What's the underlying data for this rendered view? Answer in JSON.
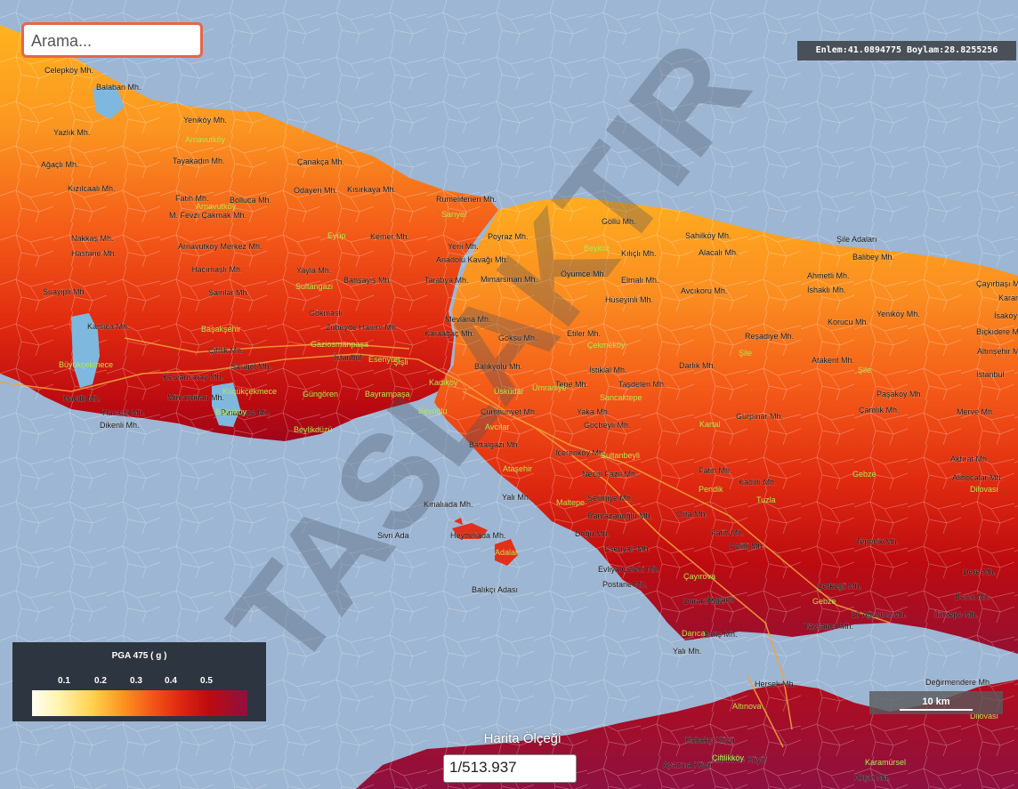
{
  "search": {
    "placeholder": "Arama..."
  },
  "coords": {
    "text": "Enlem:41.0894775 Boylam:28.8255256"
  },
  "legend": {
    "title": "PGA 475 ( g )",
    "ticks": [
      "0.1",
      "0.2",
      "0.3",
      "0.4",
      "0.5"
    ],
    "colors": [
      "#fffdf2",
      "#ffd24d",
      "#fb9521",
      "#f45a18",
      "#e02a10",
      "#bd0b10",
      "#8e1040"
    ]
  },
  "scale": {
    "label": "Harita Ölçeği",
    "value": "1/513.937"
  },
  "scalebar": {
    "label": "10 km"
  },
  "watermark": "TASLAKTIR",
  "water_color": "#9db6d3",
  "labels": {
    "black": [
      "Celepköy Mh.",
      "Balaban Mh.",
      "Yeniköy Mh.",
      "Yazlık Mh.",
      "Tayakadın Mh.",
      "Çanakça Mh.",
      "Ağaçlı Mh.",
      "Kızılcaali Mh.",
      "Fatih Mh.",
      "Bolluca Mh.",
      "Odayeri Mh.",
      "Kısırkaya Mh.",
      "Rumelifeneri Mh.",
      "M. Fevzi Çakmak Mh.",
      "Göllü Mh.",
      "Nakkaş Mh.",
      "Arnavutköy Merkez Mh.",
      "Kemer Mh.",
      "Yeni Mh.",
      "Poyraz Mh.",
      "Sahilköy Mh.",
      "Şile Adaları",
      "Hastane Mh.",
      "Kılıçlı Mh.",
      "Alacalı Mh.",
      "Balibey Mh.",
      "Anadolu Kavağı Mh.",
      "Hacımaşlı Mh.",
      "Yayla Mh.",
      "Tarabya Mh.",
      "Öyümce Mh.",
      "Ahmetli Mh.",
      "Çayırbaşı Mh.",
      "Şuayipli Mh.",
      "Bahşayiş Mh.",
      "Mimarsinan Mh.",
      "Elmalı Mh.",
      "İshaklı Mh.",
      "Karamandere Mh.",
      "Şamlar Mh.",
      "Yeniköy Mh.",
      "Avcıkoru Mh.",
      "İsaköy",
      "Hüseyinli Mh.",
      "Korucu Mh.",
      "Gökmaslı",
      "Zübeyde Hanım Mh.",
      "Mevlana Mh.",
      "Kanlıca Mh.",
      "Karaağaç Mh.",
      "Etiler Mh.",
      "Reşadiye Mh.",
      "Bıçkıdere Mh.",
      "Göksu Mh.",
      "Çiftlik Mh.",
      "Altınşehir Mh.",
      "İstanbul",
      "Sarıgöl Mh.",
      "Atakent Mh.",
      "Darlık Mh.",
      "Kervansaray Mh.",
      "Balıkyolu Mh.",
      "İstiklal Mh.",
      "İstanbul",
      "Hacıllı Mh.",
      "Mimarsinan Mh.",
      "Tepe Mh.",
      "Taşdelen Mh.",
      "Paşaköy Mh.",
      "Hasanlı Mh.",
      "Pınartepe Mh.",
      "Cumhuriyet Mh.",
      "Çamlık Mh.",
      "Yaka Mh.",
      "Merve Mh.",
      "Dikenli Mh.",
      "Gürpınar Mh.",
      "Göçbeyli Mh.",
      "Battalgazi Mh.",
      "İçerenköy Mh.",
      "Fatih Mh.",
      "Akfırat Mh.",
      "Necip Fazıl Mh.",
      "Kadıllı Mh.",
      "Alihocalar Mh.",
      "Kınalıada Mh.",
      "Yalı Mh.",
      "Selimiye Mh.",
      "Orta Mh.",
      "Ramazanoğlu Mh.",
      "Sivri Ada",
      "Heybeliada Mh.",
      "Doğu Mh.",
      "Fatih Mh.",
      "Tepecik Mh.",
      "Esenyalı Mh.",
      "Pelitli Mh.",
      "Evliya Çelebi Mh.",
      "Dere Mh.",
      "Postane Mh.",
      "Balıkçı Adası",
      "Çerkeşli Mh.",
      "Belen Mh.",
      "Duraklı Mh.",
      "Kocaeli",
      "27 Ağustos Mh.",
      "İlimtepe Mh.",
      "Barış Mh.",
      "Tavşancıl Mh.",
      "Yalı Mh.",
      "Hersek Mh.",
      "Değirmendere Mh.",
      "Kabakçı Köyü",
      "Karadere Köyü",
      "Ayazma Köyü",
      "Akçat Mh."
    ],
    "green": [
      "Arnavutköy",
      "Arnavutköy",
      "Sarıyer",
      "Eyüp",
      "Beykoz",
      "Sultangazi",
      "Başakşehir",
      "Gaziosmanpaşa",
      "Büyükçekmece",
      "Esenyurt",
      "Küçükçekmece",
      "Güngören",
      "Bayrampaşa",
      "Şişli",
      "Kadıköy",
      "Beyoğlu",
      "Üsküdar",
      "Ümraniye",
      "Çekmeköy",
      "Sancaktepe",
      "Şile",
      "Şile",
      "Beylikdüzü",
      "Bakırköy",
      "Avcılar",
      "Ataşehir",
      "Maltepe",
      "Sultanbeyli",
      "Kartal",
      "Pendik",
      "Tuzla",
      "Gebze",
      "Çayırova",
      "Darıca",
      "Gebze",
      "Dilovası",
      "Dilovası",
      "Altınova",
      "Çiftlikköy",
      "Karamürsel",
      "Adalar"
    ]
  }
}
